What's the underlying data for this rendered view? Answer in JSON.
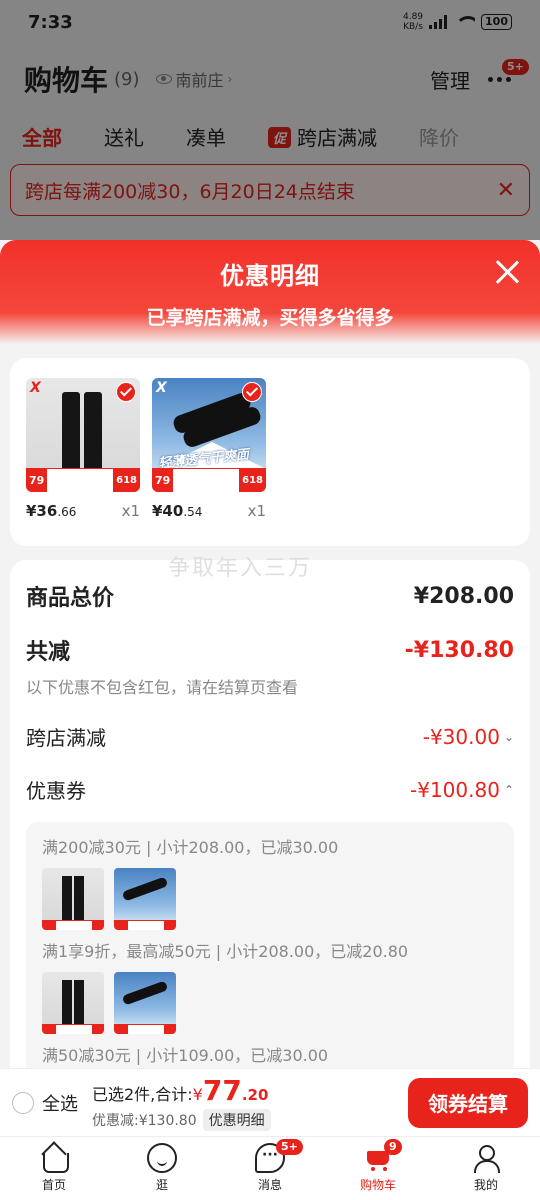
{
  "status": {
    "time": "7:33",
    "speed_value": "4.89",
    "speed_unit": "KB/s",
    "battery": "100"
  },
  "header": {
    "title": "购物车",
    "count": "(9)",
    "location": "南前庄",
    "manage": "管理",
    "more_badge": "5+"
  },
  "tabs": [
    {
      "label": "全部"
    },
    {
      "label": "送礼"
    },
    {
      "label": "凑单"
    },
    {
      "tag": "促",
      "label": "跨店满减"
    },
    {
      "label": "降价"
    }
  ],
  "banner": {
    "text": "跨店每满200减30，6月20日24点结束",
    "close": "✕"
  },
  "sheet": {
    "title": "优惠明细",
    "subtitle": "已享跨店满减，买得多省得多",
    "watermark": "争取年入三万",
    "products": [
      {
        "brand": "X",
        "price_main": "¥36",
        "price_dec": ".66",
        "qty": "x1",
        "strip_left": "79",
        "strip_right": "618"
      },
      {
        "brand": "X",
        "price_main": "¥40",
        "price_dec": ".54",
        "qty": "x1",
        "strip_left": "79",
        "strip_right": "618",
        "overlay": "轻薄透气干爽面"
      }
    ],
    "summary": {
      "total_label": "商品总价",
      "total_value": "¥208.00",
      "reduce_label": "共减",
      "reduce_value": "-¥130.80",
      "note": "以下优惠不包含红包，请在结算页查看",
      "cross_label": "跨店满减",
      "cross_value": "-¥30.00",
      "coupon_label": "优惠券",
      "coupon_value": "-¥100.80",
      "coupon_lines": [
        "满200减30元 | 小计208.00，已减30.00",
        "满1享9折，最高减50元 | 小计208.00，已减20.80",
        "满50减30元 | 小计109.00，已减30.00"
      ]
    }
  },
  "checkout": {
    "select_all": "全选",
    "selected_text": "已选2件,合计:",
    "currency": "¥",
    "amount_int": "77",
    "amount_dec": ".20",
    "discount_text": "优惠减:¥130.80",
    "detail_chip": "优惠明细",
    "button": "领券结算"
  },
  "tabbar": [
    {
      "label": "首页"
    },
    {
      "label": "逛"
    },
    {
      "label": "消息",
      "badge": "5+"
    },
    {
      "label": "购物车",
      "badge": "9"
    },
    {
      "label": "我的"
    }
  ],
  "colors": {
    "accent": "#e8231c"
  }
}
